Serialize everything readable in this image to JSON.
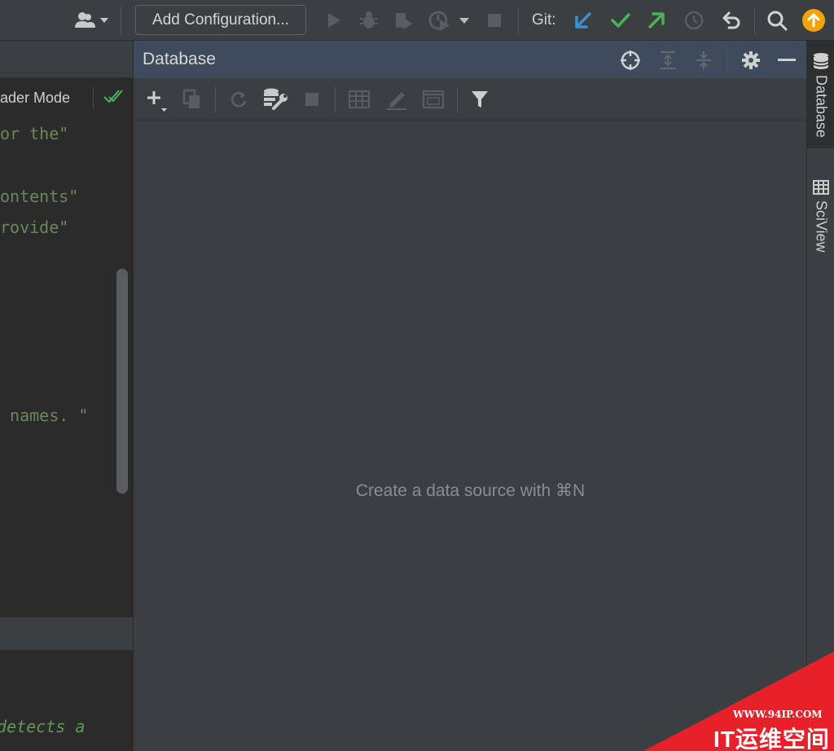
{
  "toolbar": {
    "add_configuration_label": "Add Configuration...",
    "git_label": "Git:",
    "colors": {
      "update": "#3d8fd1",
      "commit": "#4bb05a",
      "push": "#4bb05a",
      "notification": "#f0a30a"
    }
  },
  "editor": {
    "reader_mode_label": "ader Mode",
    "code_lines": [
      "or the\"",
      "ontents\"",
      "rovide\"",
      " names. \""
    ],
    "comment_line": "detects a"
  },
  "database_panel": {
    "title": "Database",
    "empty_message": "Create a data source with ⌘N"
  },
  "right_strip": {
    "tabs": [
      {
        "label": "Database"
      },
      {
        "label": "SciView"
      }
    ]
  },
  "watermark": {
    "site": "WWW.94IP.COM",
    "brand": "IT运维空间"
  }
}
